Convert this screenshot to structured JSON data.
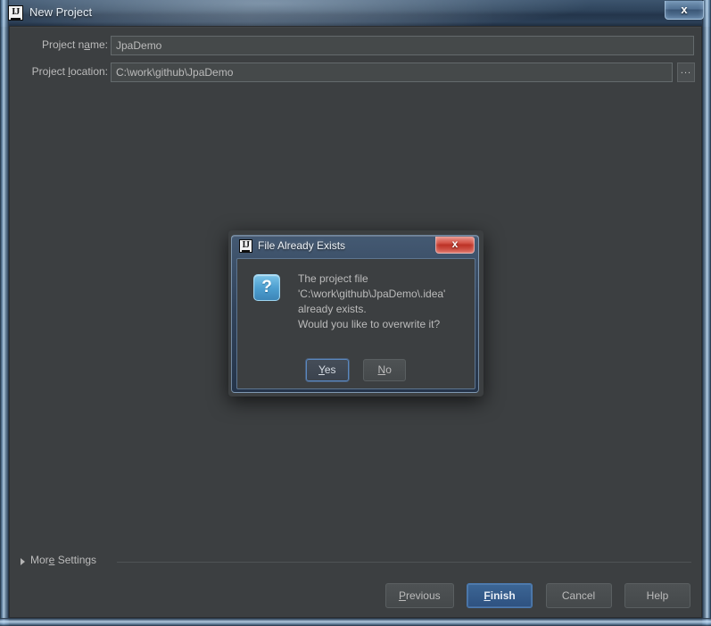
{
  "window": {
    "title": "New Project",
    "app_icon": "intellij-ij-icon",
    "close_label": "x"
  },
  "form": {
    "name_label_pre": "Project n",
    "name_label_mn": "a",
    "name_label_post": "me:",
    "name_value": "JpaDemo",
    "location_label_pre": "Project ",
    "location_label_mn": "l",
    "location_label_post": "ocation:",
    "location_value": "C:\\work\\github\\JpaDemo",
    "browse_label": "..."
  },
  "more_settings": {
    "label_pre": "Mor",
    "label_mn": "e",
    "label_post": " Settings"
  },
  "footer": {
    "buttons": [
      {
        "pre": "",
        "mn": "P",
        "post": "revious",
        "primary": false
      },
      {
        "pre": "",
        "mn": "F",
        "post": "inish",
        "primary": true
      },
      {
        "pre": "Cancel",
        "mn": "",
        "post": "",
        "primary": false
      },
      {
        "pre": "Help",
        "mn": "",
        "post": "",
        "primary": false
      }
    ]
  },
  "modal": {
    "title": "File Already Exists",
    "app_icon": "intellij-ij-icon",
    "close_label": "x",
    "icon": "question-icon",
    "icon_glyph": "?",
    "message_lines": [
      "The project file",
      "'C:\\work\\github\\JpaDemo\\.idea'",
      "already exists.",
      "Would you like to overwrite it?"
    ],
    "buttons": [
      {
        "pre": "",
        "mn": "Y",
        "post": "es",
        "focused": true
      },
      {
        "pre": "",
        "mn": "N",
        "post": "o",
        "focused": false
      }
    ]
  }
}
